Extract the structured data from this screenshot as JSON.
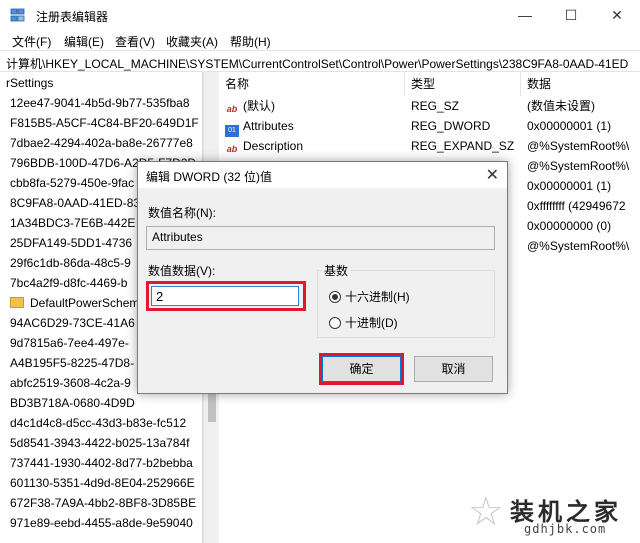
{
  "window": {
    "title": "注册表编辑器",
    "minimize_glyph": "—",
    "maximize_glyph": "☐",
    "close_glyph": "✕"
  },
  "menu": [
    "文件(F)",
    "编辑(E)",
    "查看(V)",
    "收藏夹(A)",
    "帮助(H)"
  ],
  "address": "计算机\\HKEY_LOCAL_MACHINE\\SYSTEM\\CurrentControlSet\\Control\\Power\\PowerSettings\\238C9FA8-0AAD-41ED",
  "tree": {
    "root": "rSettings",
    "items": [
      "12ee47-9041-4b5d-9b77-535fba8",
      "F815B5-A5CF-4C84-BF20-649D1F",
      "7dbae2-4294-402a-ba8e-26777e8",
      "796BDB-100D-47D6-A2D5-F7D2D",
      "cbb8fa-5279-450e-9fac",
      "8C9FA8-0AAD-41ED-83",
      "1A34BDC3-7E6B-442E",
      "25DFA149-5DD1-4736",
      "29f6c1db-86da-48c5-9",
      "7bc4a2f9-d8fc-4469-b",
      "DefaultPowerScheme",
      "94AC6D29-73CE-41A6",
      "9d7815a6-7ee4-497e-",
      "A4B195F5-8225-47D8-",
      "abfc2519-3608-4c2a-9",
      "BD3B718A-0680-4D9D",
      "d4c1d4c8-d5cc-43d3-b83e-fc512",
      "5d8541-3943-4422-b025-13a784f",
      "737441-1930-4402-8d77-b2bebba",
      "601130-5351-4d9d-8E04-252966E",
      "672F38-7A9A-4bb2-8BF8-3D85BE",
      "971e89-eebd-4455-a8de-9e59040"
    ]
  },
  "list": {
    "headers": {
      "name": "名称",
      "type": "类型",
      "data": "数据"
    },
    "rows": [
      {
        "icon": "ab",
        "name": "(默认)",
        "type": "REG_SZ",
        "data": "(数值未设置)"
      },
      {
        "icon": "bin",
        "name": "Attributes",
        "type": "REG_DWORD",
        "data": "0x00000001 (1)"
      },
      {
        "icon": "ab",
        "name": "Description",
        "type": "REG_EXPAND_SZ",
        "data": "@%SystemRoot%\\"
      },
      {
        "icon": "",
        "name": "",
        "type": "",
        "data": "@%SystemRoot%\\"
      },
      {
        "icon": "",
        "name": "",
        "type": "",
        "data": "0x00000001 (1)"
      },
      {
        "icon": "",
        "name": "",
        "type": "",
        "data": "0xffffffff (42949672"
      },
      {
        "icon": "",
        "name": "",
        "type": "",
        "data": "0x00000000 (0)"
      },
      {
        "icon": "",
        "name": "",
        "type": "",
        "data": "@%SystemRoot%\\"
      }
    ]
  },
  "dialog": {
    "title": "编辑 DWORD (32 位)值",
    "close_glyph": "✕",
    "name_label": "数值名称(N):",
    "name_value": "Attributes",
    "data_label": "数值数据(V):",
    "data_value": "2",
    "base_label": "基数",
    "radio_hex": "十六进制(H)",
    "radio_dec": "十进制(D)",
    "selected_base": "hex",
    "ok_label": "确定",
    "cancel_label": "取消"
  },
  "watermark": {
    "title": "装机之家",
    "url": "gdhjbk.com",
    "star_glyph": "☆"
  },
  "colors": {
    "highlight": "#e0182f",
    "focus_border": "#0078d7"
  }
}
